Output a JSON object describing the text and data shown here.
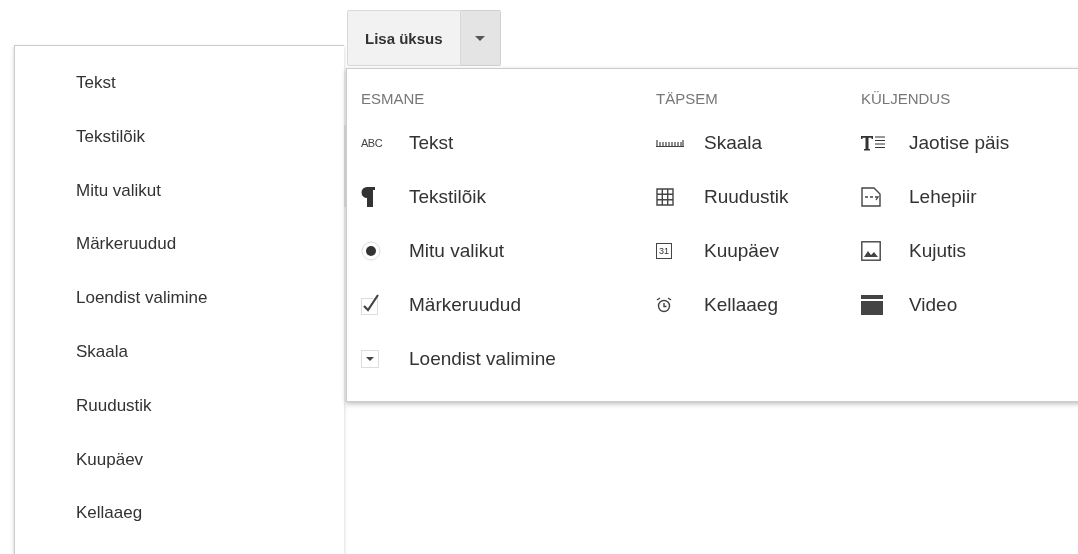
{
  "left_menu": {
    "items": [
      "Tekst",
      "Tekstilõik",
      "Mitu valikut",
      "Märkeruudud",
      "Loendist valimine",
      "Skaala",
      "Ruudustik",
      "Kuupäev",
      "Kellaaeg"
    ]
  },
  "add_button": {
    "label": "Lisa üksus"
  },
  "add_menu": {
    "columns": [
      {
        "heading": "ESMANE",
        "items": [
          {
            "label": "Tekst",
            "kind": "text",
            "icon_text": "ABC"
          },
          {
            "label": "Tekstilõik",
            "kind": "paragraph"
          },
          {
            "label": "Mitu valikut",
            "kind": "radio"
          },
          {
            "label": "Märkeruudud",
            "kind": "checkbox"
          },
          {
            "label": "Loendist valimine",
            "kind": "dropdown"
          }
        ]
      },
      {
        "heading": "TÄPSEM",
        "items": [
          {
            "label": "Skaala",
            "kind": "scale"
          },
          {
            "label": "Ruudustik",
            "kind": "grid"
          },
          {
            "label": "Kuupäev",
            "kind": "date",
            "icon_text": "31"
          },
          {
            "label": "Kellaaeg",
            "kind": "time"
          }
        ]
      },
      {
        "heading": "KÜLJENDUS",
        "items": [
          {
            "label": "Jaotise päis",
            "kind": "header"
          },
          {
            "label": "Lehepiir",
            "kind": "pagebreak"
          },
          {
            "label": "Kujutis",
            "kind": "image"
          },
          {
            "label": "Video",
            "kind": "video"
          }
        ]
      }
    ]
  }
}
